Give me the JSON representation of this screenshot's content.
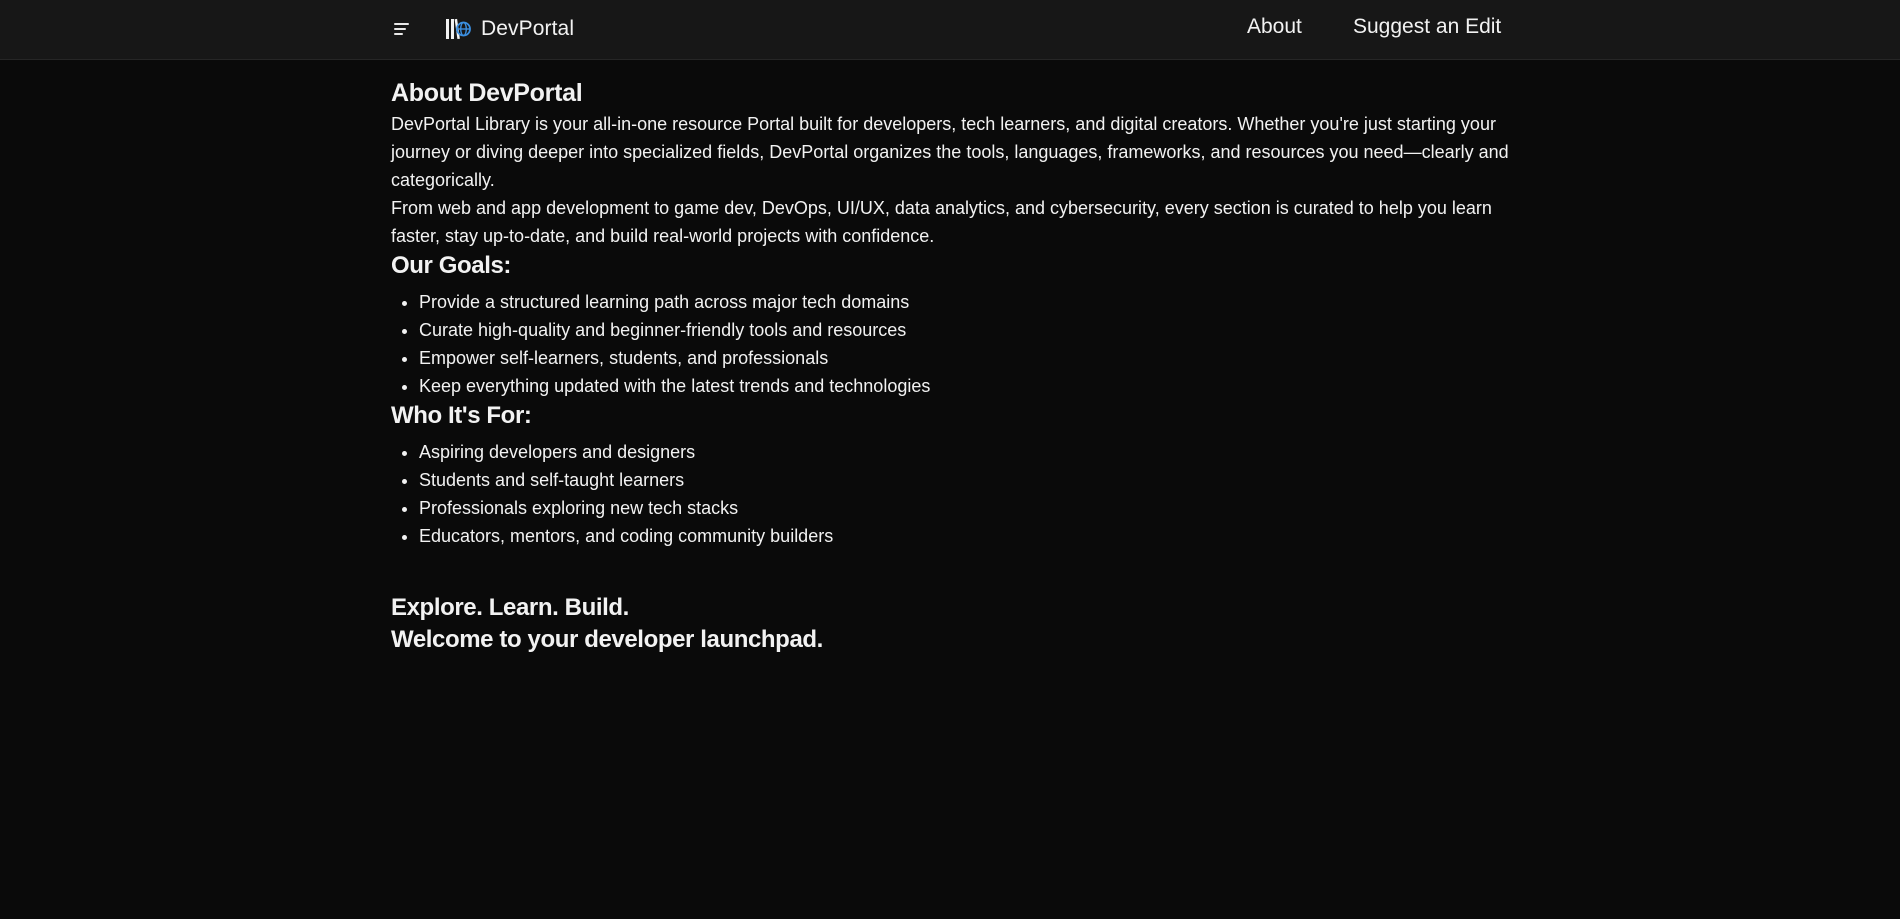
{
  "header": {
    "brand_name": "DevPortal",
    "brand_logo_icon": "library-books-globe-icon",
    "menu_icon": "menu-lines-icon",
    "nav": [
      {
        "label": "About"
      },
      {
        "label": "Suggest an Edit"
      }
    ]
  },
  "main": {
    "title": "About DevPortal",
    "paragraphs": [
      "DevPortal Library is your all-in-one resource Portal built for developers, tech learners, and digital creators. Whether you're just starting your journey or diving deeper into specialized fields, DevPortal organizes the tools, languages, frameworks, and resources you need—clearly and categorically.",
      "From web and app development to game dev, DevOps, UI/UX, data analytics, and cybersecurity, every section is curated to help you learn faster, stay up-to-date, and build real-world projects with confidence."
    ],
    "goals": {
      "heading": "Our Goals:",
      "items": [
        "Provide a structured learning path across major tech domains",
        "Curate high-quality and beginner-friendly tools and resources",
        "Empower self-learners, students, and professionals",
        "Keep everything updated with the latest trends and technologies"
      ]
    },
    "audience": {
      "heading": "Who It's For:",
      "items": [
        "Aspiring developers and designers",
        "Students and self-taught learners",
        "Professionals exploring new tech stacks",
        "Educators, mentors, and coding community builders"
      ]
    },
    "closing": {
      "line1": "Explore. Learn. Build.",
      "line2": "Welcome to your developer launchpad."
    }
  },
  "colors": {
    "background": "#0a0a0a",
    "header_background": "#171717",
    "text": "#f2f2f2",
    "logo_accent": "#3b8fe0"
  }
}
